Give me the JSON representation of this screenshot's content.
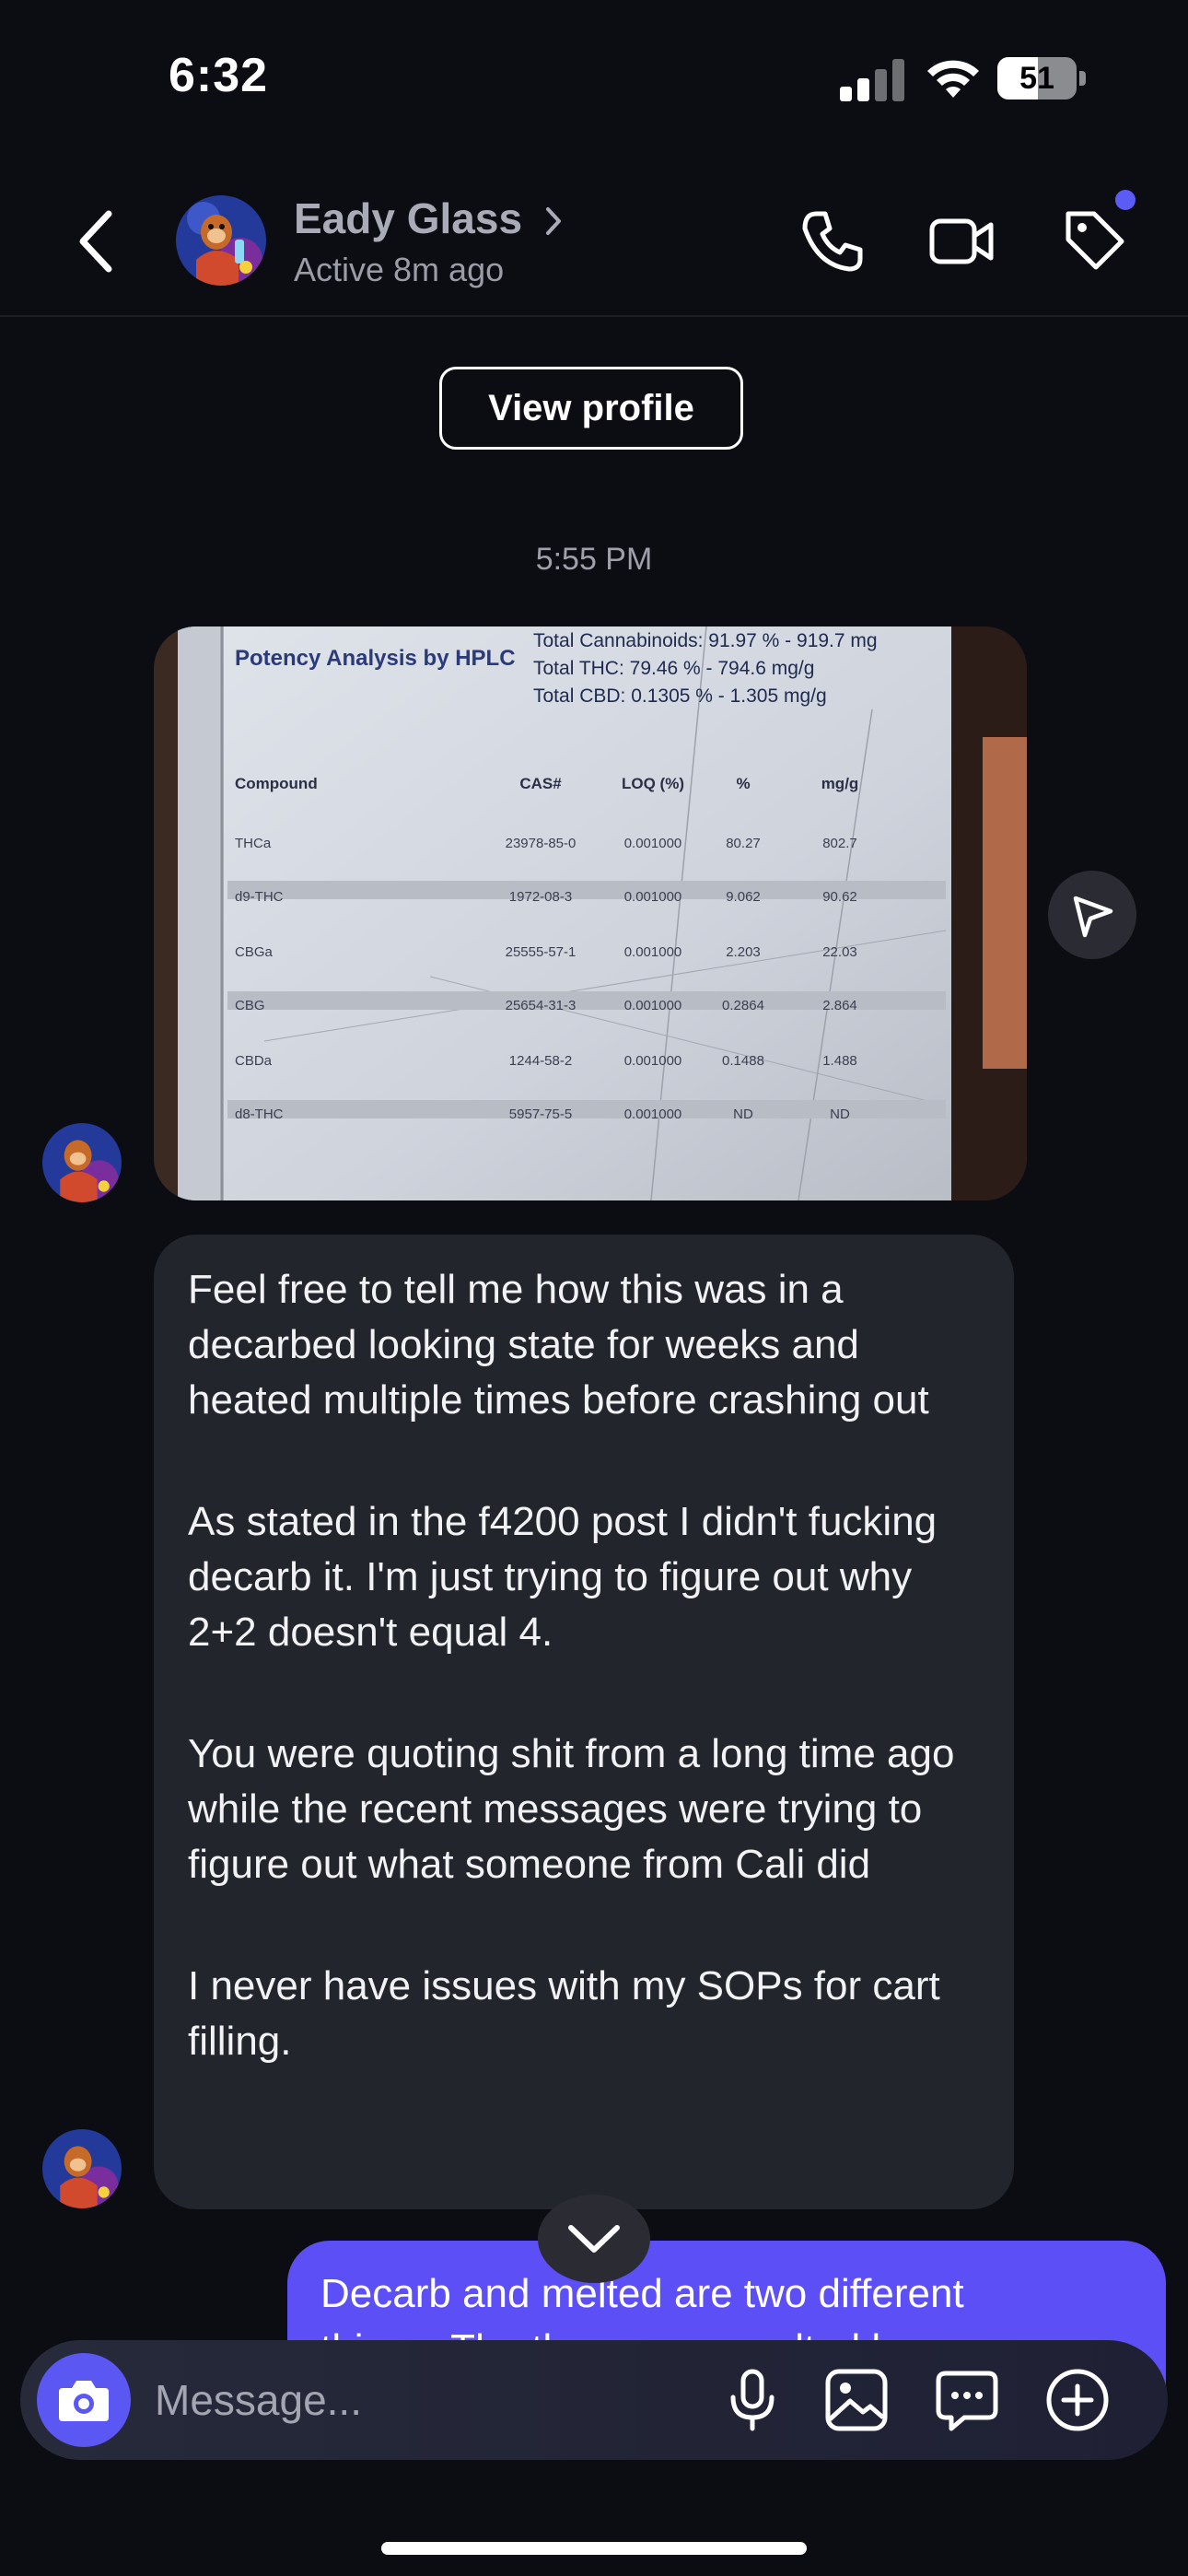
{
  "status_bar": {
    "time": "6:32",
    "battery": "51",
    "battery_level": 0.51
  },
  "header": {
    "contact_name": "Eady Glass",
    "status": "Active 8m ago",
    "icons": [
      "back-chevron-icon",
      "phone-icon",
      "video-camera-icon",
      "tag-icon"
    ],
    "notification_dot_color": "#5b5cf5"
  },
  "view_profile_label": "View profile",
  "timestamp": "5:55 PM",
  "photo": {
    "title": "Potency Analysis by HPLC",
    "totals": [
      "Total Cannabinoids: 91.97 % - 919.7 mg",
      "Total THC: 79.46 % - 794.6 mg/g",
      "Total CBD: 0.1305 % - 1.305 mg/g"
    ],
    "headers": [
      "Compound",
      "CAS#",
      "LOQ (%)",
      "%",
      "mg/g"
    ],
    "rows": [
      [
        "THCa",
        "23978-85-0",
        "0.001000",
        "80.27",
        "802.7"
      ],
      [
        "d9-THC",
        "1972-08-3",
        "0.001000",
        "9.062",
        "90.62"
      ],
      [
        "CBGa",
        "25555-57-1",
        "0.001000",
        "2.203",
        "22.03"
      ],
      [
        "CBG",
        "25654-31-3",
        "0.001000",
        "0.2864",
        "2.864"
      ],
      [
        "CBDa",
        "1244-58-2",
        "0.001000",
        "0.1488",
        "1.488"
      ],
      [
        "d8-THC",
        "5957-75-5",
        "0.001000",
        "ND",
        "ND"
      ]
    ]
  },
  "incoming_message": {
    "paragraphs": [
      "Feel free to tell me how this was in a decarbed looking state for weeks and heated multiple times before crashing out",
      "As stated in the f4200 post I didn't fucking decarb it. I'm just trying to figure out why 2+2 doesn't equal 4.",
      "You were quoting shit from a long time ago while the recent messages were trying to figure out what someone from Cali did",
      "I never have issues with my SOPs for cart filling."
    ]
  },
  "outgoing_message": {
    "line1": "Decarb and melted are two different",
    "line2": "things. The theory was melted by"
  },
  "composer": {
    "placeholder": "Message...",
    "icons": [
      "camera-icon",
      "microphone-icon",
      "gallery-icon",
      "sticker-icon",
      "plus-icon"
    ]
  },
  "colors": {
    "background": "#0c0d13",
    "incoming_bubble": "#23252c",
    "outgoing_bubble": "#5b4ff5",
    "accent": "#5b57f3"
  }
}
